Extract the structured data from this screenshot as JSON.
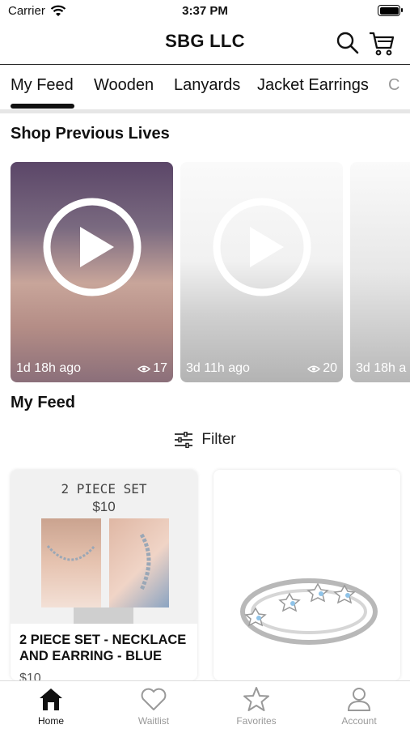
{
  "status_bar": {
    "carrier": "Carrier",
    "time": "3:37 PM"
  },
  "header": {
    "title": "SBG LLC"
  },
  "tabs": [
    {
      "label": "My Feed"
    },
    {
      "label": "Wooden"
    },
    {
      "label": "Lanyards"
    },
    {
      "label": "Jacket Earrings"
    },
    {
      "label": "C"
    }
  ],
  "sections": {
    "previous_lives": "Shop Previous Lives",
    "feed": "My Feed"
  },
  "videos": [
    {
      "ago": "1d 18h ago",
      "views": "17"
    },
    {
      "ago": "3d 11h ago",
      "views": "20"
    },
    {
      "ago": "3d 18h a"
    }
  ],
  "filter": {
    "label": "Filter"
  },
  "products": [
    {
      "image_text_line1": "2 PIECE SET",
      "image_text_line2": "$10",
      "name": "2 PIECE SET - NECKLACE AND EARRING - BLUE",
      "price": "$10"
    }
  ],
  "bottom_nav": [
    {
      "label": "Home",
      "icon": "home-icon"
    },
    {
      "label": "Waitlist",
      "icon": "heart-icon"
    },
    {
      "label": "Favorites",
      "icon": "star-icon"
    },
    {
      "label": "Account",
      "icon": "person-icon"
    }
  ],
  "colors": {
    "accent": "#111111",
    "inactive": "#999999",
    "tab_underline": "#e6e6e6"
  }
}
